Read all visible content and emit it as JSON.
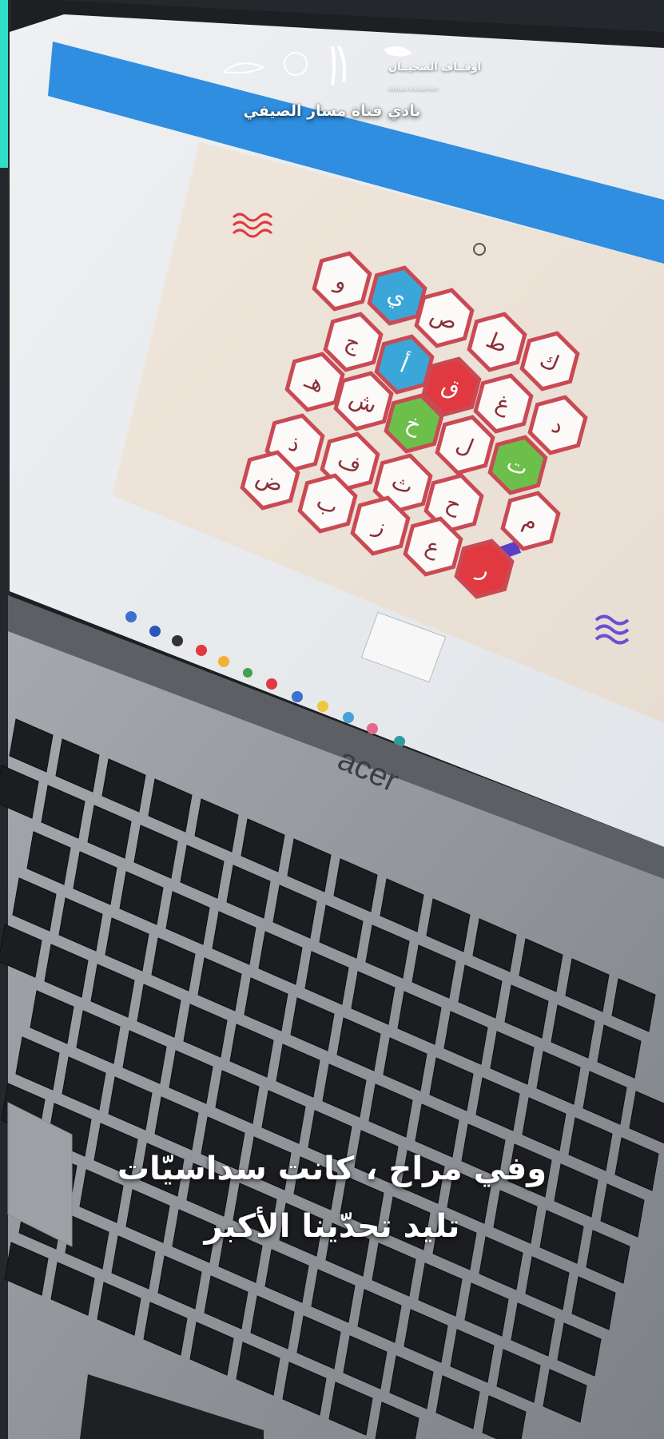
{
  "header": {
    "club_title": "نادي فتاة مسار الصيفي",
    "awqaf_logo_text": "اوقــاف الضحيــان",
    "awqaf_logo_subtext": "Aldhyan Endowment"
  },
  "caption": {
    "line_1": "وفي مراح ، كانت سداسيّات",
    "line_2": "تليد تحدّينا الأكبر"
  },
  "board": {
    "letters": [
      "و",
      "ي",
      "ص",
      "ط",
      "ك",
      "ج",
      "أ",
      "ق",
      "غ",
      "د",
      "هـ",
      "ش",
      "خ",
      "ل",
      "ت",
      "ذ",
      "ف",
      "ث",
      "ح",
      "م",
      "ض",
      "ب",
      "ز",
      "ع",
      "ر"
    ]
  },
  "keyboard": {
    "brand": "acer"
  },
  "colors": {
    "hex_red": "#e0393f",
    "hex_blue": "#3aa7d8",
    "hex_green": "#6cbf4a",
    "hex_outline": "#c94a55",
    "accent_purple": "#6b4fd3",
    "side_accent": "#2fe0c8"
  }
}
